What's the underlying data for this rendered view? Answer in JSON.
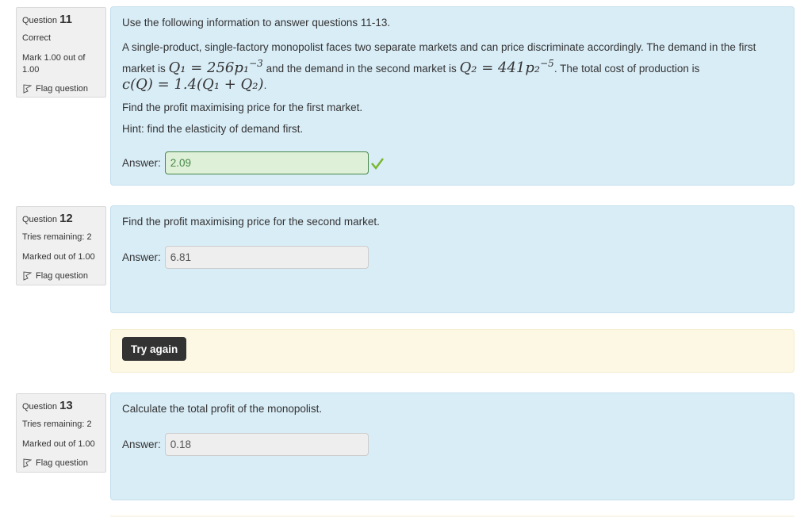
{
  "questions": [
    {
      "number_label": "Question",
      "number": "11",
      "status": "Correct",
      "mark": "Mark 1.00 out of 1.00",
      "flag_label": "Flag question",
      "intro": "Use the following information to answer questions 11-13.",
      "body_part1": "A single-product, single-factory monopolist faces two separate markets and can price discriminate accordingly. The demand in the first market is",
      "math_q1": "Q₁ = 256p₁",
      "math_q1_exp": "−3",
      "body_part2": "and the demand in the second market is",
      "math_q2": "Q₂ = 441p₂",
      "math_q2_exp": "−5",
      "body_part3": ". The total cost of production is",
      "math_cost": "c(Q) = 1.4(Q₁ + Q₂)",
      "prompt": "Find the profit maximising price for the first market.",
      "hint": "Hint: find the elasticity of demand first.",
      "answer_label": "Answer:",
      "answer_value": "2.09",
      "answer_state": "correct"
    },
    {
      "number_label": "Question",
      "number": "12",
      "status": "Tries remaining: 2",
      "mark": "Marked out of 1.00",
      "flag_label": "Flag question",
      "prompt": "Find the profit maximising price for the second market.",
      "answer_label": "Answer:",
      "answer_value": "6.81",
      "try_again_label": "Try again"
    },
    {
      "number_label": "Question",
      "number": "13",
      "status": "Tries remaining: 2",
      "mark": "Marked out of 1.00",
      "flag_label": "Flag question",
      "prompt": "Calculate the total profit of the monopolist.",
      "answer_label": "Answer:",
      "answer_value": "0.18"
    }
  ],
  "colors": {
    "content_bg": "#d9edf7",
    "info_bg": "#f0f0f0",
    "correct_bg": "#dff0d8",
    "correct_check": "#7ab730",
    "warning_bg": "#fcf8e3",
    "button_bg": "#333333"
  }
}
